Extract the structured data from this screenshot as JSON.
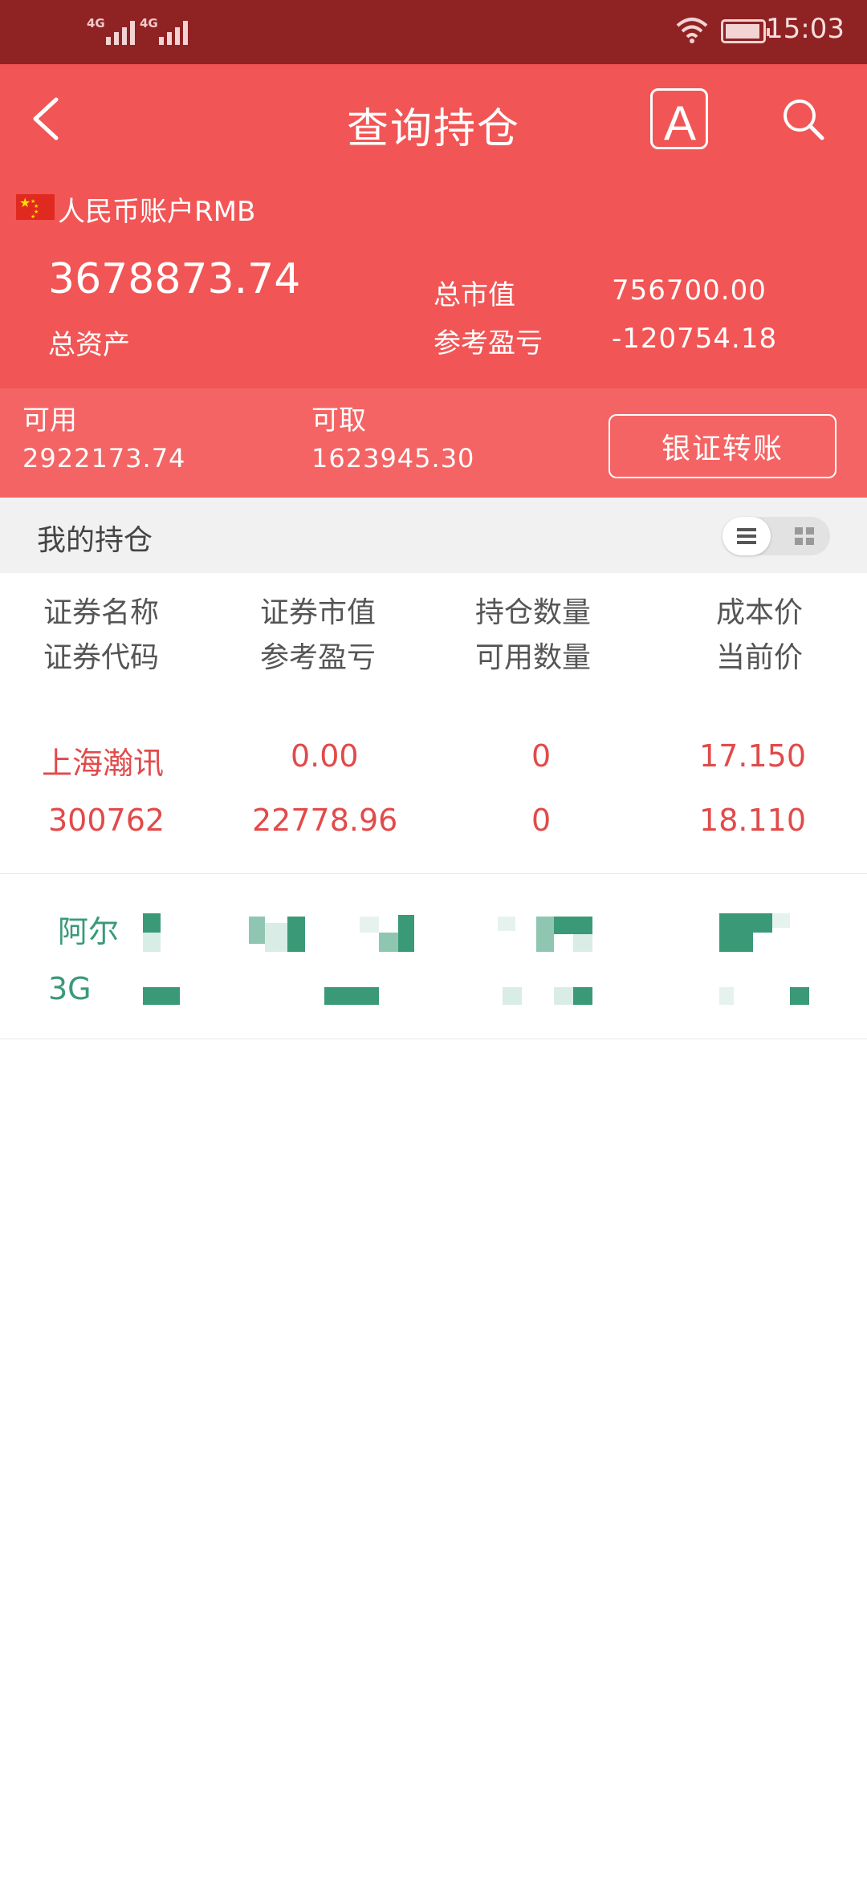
{
  "status_bar": {
    "signal1": "4G",
    "signal2": "4G",
    "time": "15:03"
  },
  "nav": {
    "title": "查询持仓",
    "font_button": "A"
  },
  "account": {
    "name": "人民币账户RMB",
    "total_assets": "3678873.74",
    "total_assets_label": "总资产",
    "market_value_label": "总市值",
    "market_value": "756700.00",
    "profit_label": "参考盈亏",
    "profit": "-120754.18",
    "available_label": "可用",
    "available": "2922173.74",
    "withdrawable_label": "可取",
    "withdrawable": "1623945.30",
    "transfer_button": "银证转账"
  },
  "holdings": {
    "section_title": "我的持仓",
    "columns": [
      {
        "line1": "证券名称",
        "line2": "证券代码"
      },
      {
        "line1": "证券市值",
        "line2": "参考盈亏"
      },
      {
        "line1": "持仓数量",
        "line2": "可用数量"
      },
      {
        "line1": "成本价",
        "line2": "当前价"
      }
    ],
    "rows": [
      {
        "name": "上海瀚讯",
        "code": "300762",
        "market_value": "0.00",
        "profit": "22778.96",
        "quantity": "0",
        "available_qty": "0",
        "cost": "17.150",
        "price": "18.110",
        "color": "#e24a4a"
      },
      {
        "name": "阿尔",
        "code": "3G",
        "color": "#3a9a78"
      }
    ]
  },
  "colors": {
    "header": "#f25555",
    "status_bar": "#8f2222",
    "gain": "#e24a4a",
    "loss": "#3a9a78"
  }
}
